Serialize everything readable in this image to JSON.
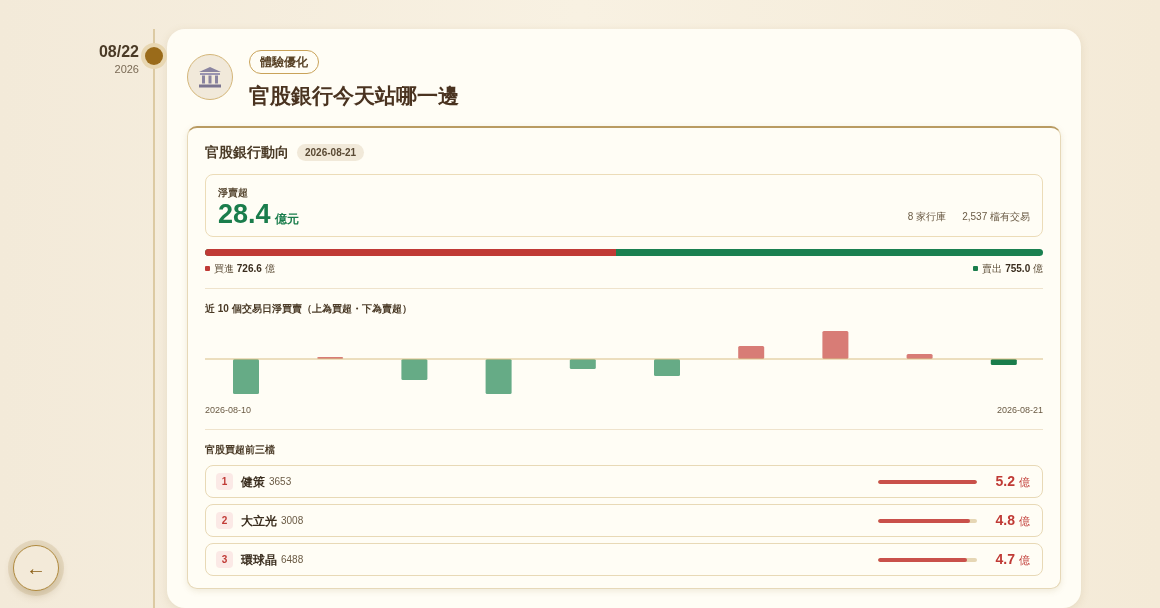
{
  "timeline": {
    "date": "08/22",
    "year": "2026"
  },
  "entry": {
    "tag": "體驗優化",
    "title": "官股銀行今天站哪一邊",
    "panel": {
      "title": "官股銀行動向",
      "date": "2026-08-21",
      "net": {
        "kind": "sell",
        "label": "淨賣超",
        "value": "28.4",
        "unit": "億元",
        "brokers": "8 家行庫",
        "stocks": "2,537 檔有交易"
      },
      "split": {
        "level": 0.49,
        "buy_label": "買進",
        "buy_value": "726.6",
        "buy_unit": "億",
        "sell_label": "賣出",
        "sell_value": "755.0",
        "sell_unit": "億"
      },
      "chart": {
        "title": "近 10 個交易日淨買賣（上為買超・下為賣超）",
        "start": "2026-08-10",
        "end": "2026-08-21"
      },
      "top_title": "官股買超前三檔",
      "top": [
        {
          "rank": "1",
          "name": "健策",
          "code": "3653",
          "level": 1,
          "amount": "5.2",
          "unit": "億"
        },
        {
          "rank": "2",
          "name": "大立光",
          "code": "3008",
          "level": 0.93,
          "amount": "4.8",
          "unit": "億"
        },
        {
          "rank": "3",
          "name": "環球晶",
          "code": "6488",
          "level": 0.9,
          "amount": "4.7",
          "unit": "億"
        }
      ]
    }
  },
  "back_button": {
    "label": "←"
  }
}
